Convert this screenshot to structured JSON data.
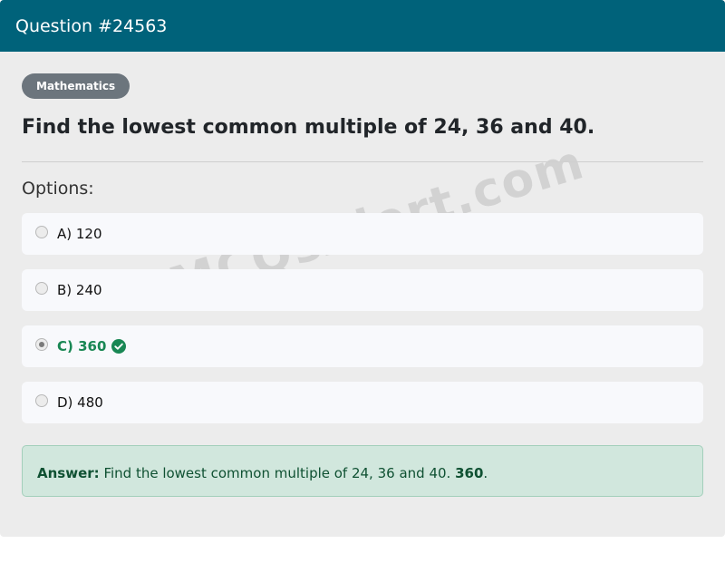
{
  "header": {
    "title": "Question #24563"
  },
  "question": {
    "category": "Mathematics",
    "text": "Find the lowest common multiple of 24, 36 and 40.",
    "options_label": "Options:",
    "options": [
      {
        "label": "A) 120",
        "selected": false,
        "correct": false
      },
      {
        "label": "B) 240",
        "selected": false,
        "correct": false
      },
      {
        "label": "C) 360",
        "selected": true,
        "correct": true
      },
      {
        "label": "D) 480",
        "selected": false,
        "correct": false
      }
    ]
  },
  "answer": {
    "prefix": "Answer:",
    "text": "Find the lowest common multiple of 24, 36 and 40.",
    "value": "360",
    "suffix": "."
  },
  "watermark": "MCQsAlert.com",
  "colors": {
    "header_bg": "#00627a",
    "badge_bg": "#6c757d",
    "correct_green": "#198754",
    "answer_bg": "#d1e7dd"
  },
  "icons": {
    "correct": "check-circle-icon"
  }
}
